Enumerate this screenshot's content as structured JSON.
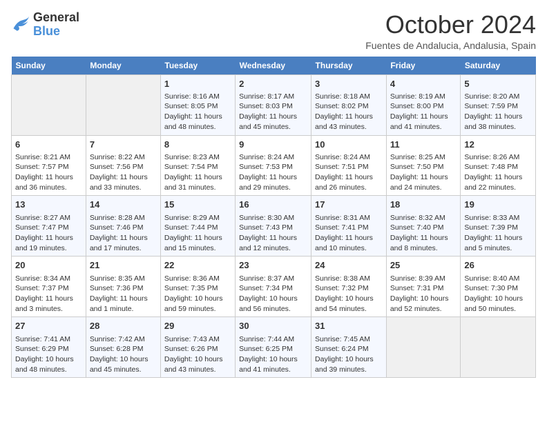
{
  "logo": {
    "line1": "General",
    "line2": "Blue"
  },
  "title": "October 2024",
  "subtitle": "Fuentes de Andalucia, Andalusia, Spain",
  "days_of_week": [
    "Sunday",
    "Monday",
    "Tuesday",
    "Wednesday",
    "Thursday",
    "Friday",
    "Saturday"
  ],
  "weeks": [
    [
      {
        "day": "",
        "info": ""
      },
      {
        "day": "",
        "info": ""
      },
      {
        "day": "1",
        "info": "Sunrise: 8:16 AM\nSunset: 8:05 PM\nDaylight: 11 hours and 48 minutes."
      },
      {
        "day": "2",
        "info": "Sunrise: 8:17 AM\nSunset: 8:03 PM\nDaylight: 11 hours and 45 minutes."
      },
      {
        "day": "3",
        "info": "Sunrise: 8:18 AM\nSunset: 8:02 PM\nDaylight: 11 hours and 43 minutes."
      },
      {
        "day": "4",
        "info": "Sunrise: 8:19 AM\nSunset: 8:00 PM\nDaylight: 11 hours and 41 minutes."
      },
      {
        "day": "5",
        "info": "Sunrise: 8:20 AM\nSunset: 7:59 PM\nDaylight: 11 hours and 38 minutes."
      }
    ],
    [
      {
        "day": "6",
        "info": "Sunrise: 8:21 AM\nSunset: 7:57 PM\nDaylight: 11 hours and 36 minutes."
      },
      {
        "day": "7",
        "info": "Sunrise: 8:22 AM\nSunset: 7:56 PM\nDaylight: 11 hours and 33 minutes."
      },
      {
        "day": "8",
        "info": "Sunrise: 8:23 AM\nSunset: 7:54 PM\nDaylight: 11 hours and 31 minutes."
      },
      {
        "day": "9",
        "info": "Sunrise: 8:24 AM\nSunset: 7:53 PM\nDaylight: 11 hours and 29 minutes."
      },
      {
        "day": "10",
        "info": "Sunrise: 8:24 AM\nSunset: 7:51 PM\nDaylight: 11 hours and 26 minutes."
      },
      {
        "day": "11",
        "info": "Sunrise: 8:25 AM\nSunset: 7:50 PM\nDaylight: 11 hours and 24 minutes."
      },
      {
        "day": "12",
        "info": "Sunrise: 8:26 AM\nSunset: 7:48 PM\nDaylight: 11 hours and 22 minutes."
      }
    ],
    [
      {
        "day": "13",
        "info": "Sunrise: 8:27 AM\nSunset: 7:47 PM\nDaylight: 11 hours and 19 minutes."
      },
      {
        "day": "14",
        "info": "Sunrise: 8:28 AM\nSunset: 7:46 PM\nDaylight: 11 hours and 17 minutes."
      },
      {
        "day": "15",
        "info": "Sunrise: 8:29 AM\nSunset: 7:44 PM\nDaylight: 11 hours and 15 minutes."
      },
      {
        "day": "16",
        "info": "Sunrise: 8:30 AM\nSunset: 7:43 PM\nDaylight: 11 hours and 12 minutes."
      },
      {
        "day": "17",
        "info": "Sunrise: 8:31 AM\nSunset: 7:41 PM\nDaylight: 11 hours and 10 minutes."
      },
      {
        "day": "18",
        "info": "Sunrise: 8:32 AM\nSunset: 7:40 PM\nDaylight: 11 hours and 8 minutes."
      },
      {
        "day": "19",
        "info": "Sunrise: 8:33 AM\nSunset: 7:39 PM\nDaylight: 11 hours and 5 minutes."
      }
    ],
    [
      {
        "day": "20",
        "info": "Sunrise: 8:34 AM\nSunset: 7:37 PM\nDaylight: 11 hours and 3 minutes."
      },
      {
        "day": "21",
        "info": "Sunrise: 8:35 AM\nSunset: 7:36 PM\nDaylight: 11 hours and 1 minute."
      },
      {
        "day": "22",
        "info": "Sunrise: 8:36 AM\nSunset: 7:35 PM\nDaylight: 10 hours and 59 minutes."
      },
      {
        "day": "23",
        "info": "Sunrise: 8:37 AM\nSunset: 7:34 PM\nDaylight: 10 hours and 56 minutes."
      },
      {
        "day": "24",
        "info": "Sunrise: 8:38 AM\nSunset: 7:32 PM\nDaylight: 10 hours and 54 minutes."
      },
      {
        "day": "25",
        "info": "Sunrise: 8:39 AM\nSunset: 7:31 PM\nDaylight: 10 hours and 52 minutes."
      },
      {
        "day": "26",
        "info": "Sunrise: 8:40 AM\nSunset: 7:30 PM\nDaylight: 10 hours and 50 minutes."
      }
    ],
    [
      {
        "day": "27",
        "info": "Sunrise: 7:41 AM\nSunset: 6:29 PM\nDaylight: 10 hours and 48 minutes."
      },
      {
        "day": "28",
        "info": "Sunrise: 7:42 AM\nSunset: 6:28 PM\nDaylight: 10 hours and 45 minutes."
      },
      {
        "day": "29",
        "info": "Sunrise: 7:43 AM\nSunset: 6:26 PM\nDaylight: 10 hours and 43 minutes."
      },
      {
        "day": "30",
        "info": "Sunrise: 7:44 AM\nSunset: 6:25 PM\nDaylight: 10 hours and 41 minutes."
      },
      {
        "day": "31",
        "info": "Sunrise: 7:45 AM\nSunset: 6:24 PM\nDaylight: 10 hours and 39 minutes."
      },
      {
        "day": "",
        "info": ""
      },
      {
        "day": "",
        "info": ""
      }
    ]
  ]
}
